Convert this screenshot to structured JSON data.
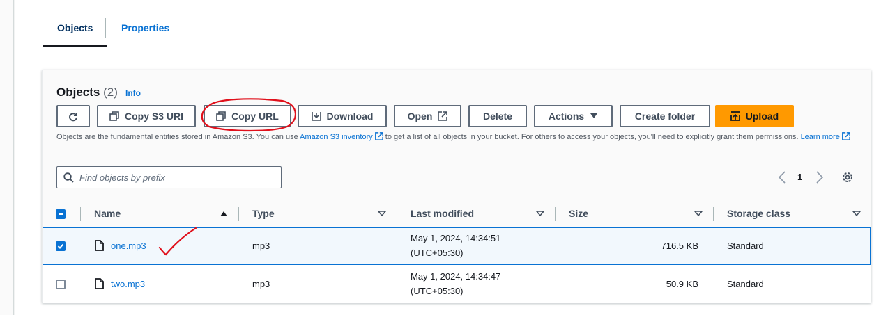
{
  "tabs": [
    {
      "label": "Objects",
      "active": true
    },
    {
      "label": "Properties",
      "active": false
    }
  ],
  "panel": {
    "title": "Objects",
    "count": "(2)",
    "info_label": "Info"
  },
  "toolbar": {
    "copy_s3_uri": "Copy S3 URI",
    "copy_url": "Copy URL",
    "download": "Download",
    "open": "Open",
    "delete": "Delete",
    "actions": "Actions",
    "create_folder": "Create folder",
    "upload": "Upload"
  },
  "description": {
    "part1": "Objects are the fundamental entities stored in Amazon S3. You can use ",
    "link1": "Amazon S3 inventory",
    "part2": " to get a list of all objects in your bucket. For others to access your objects, you'll need to explicitly grant them permissions. ",
    "link2": "Learn more"
  },
  "search": {
    "placeholder": "Find objects by prefix",
    "value": ""
  },
  "pagination": {
    "current_page": "1"
  },
  "table": {
    "columns": [
      "Name",
      "Type",
      "Last modified",
      "Size",
      "Storage class"
    ],
    "rows": [
      {
        "name": "one.mp3",
        "type": "mp3",
        "modified_date": "May 1, 2024, 14:34:51",
        "modified_tz": "(UTC+05:30)",
        "size": "716.5 KB",
        "storage_class": "Standard",
        "selected": true
      },
      {
        "name": "two.mp3",
        "type": "mp3",
        "modified_date": "May 1, 2024, 14:34:47",
        "modified_tz": "(UTC+05:30)",
        "size": "50.9 KB",
        "storage_class": "Standard",
        "selected": false
      }
    ]
  },
  "colors": {
    "link": "#0972d3",
    "upload": "#ff9900",
    "annotation": "#e0101b"
  },
  "icons": [
    "refresh-icon",
    "copy-icon",
    "download-icon",
    "external-link-icon",
    "caret-down-icon",
    "upload-icon",
    "search-icon",
    "chevron-left-icon",
    "chevron-right-icon",
    "gear-icon",
    "sort-ascending-icon",
    "sort-descending-icon",
    "file-icon"
  ]
}
